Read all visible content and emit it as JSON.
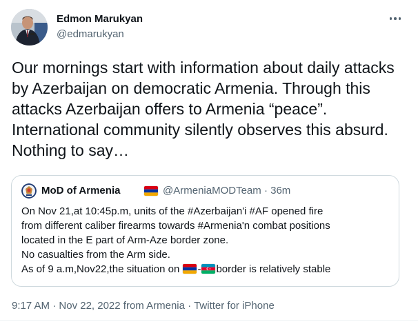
{
  "author": {
    "name": "Edmon Marukyan",
    "handle": "@edmarukyan"
  },
  "tweet": {
    "text": "Our mornings start with information about daily attacks by Azerbaijan on democratic Armenia. Through this attacks Azerbaijan offers to Armenia “peace”. International community silently observes this absurd. Nothing to say…"
  },
  "quote": {
    "name": "MoD of Armenia",
    "handle": "@ArmeniaMODTeam",
    "separator": "·",
    "time_ago": "36m",
    "lines": [
      "On Nov 21,at 10:45p.m, units of the #Azerbaijan'i #AF opened fire",
      "from different caliber firearms towards #Armenia'n combat positions",
      "located in the E part of Arm-Aze border zone.",
      "No casualties from the Arm side."
    ],
    "last_line_prefix": "As of 9 a.m,Nov22,the situation on ",
    "last_line_dash": "-",
    "last_line_suffix": "border is relatively stable"
  },
  "footer": {
    "time": "9:17 AM",
    "sep1": "·",
    "date": "Nov 22, 2022 from Armenia",
    "sep2": "·",
    "source": "Twitter for iPhone"
  },
  "icons": {
    "more": "more-horizontal-icon",
    "armenia_flag": "armenia-flag-icon",
    "azerbaijan_flag": "azerbaijan-flag-icon",
    "mod_logo": "mod-armenia-emblem-icon"
  },
  "colors": {
    "text_primary": "#0f1419",
    "text_secondary": "#536471",
    "border": "#cfd9de"
  }
}
